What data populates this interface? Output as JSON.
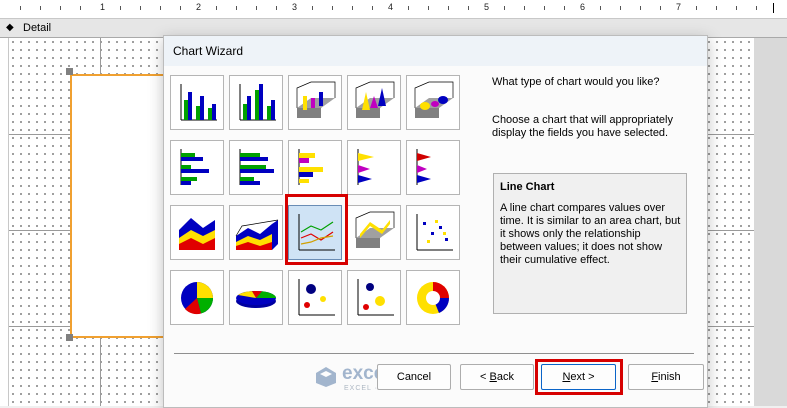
{
  "ruler": {
    "numbers": [
      "1",
      "2",
      "3",
      "4",
      "5",
      "6",
      "7"
    ]
  },
  "section": {
    "caret": "◆",
    "label": "Detail"
  },
  "dialog": {
    "title": "Chart Wizard",
    "question": "What type of chart would you like?",
    "instructions": "Choose a chart that will appropriately display the fields you have selected.",
    "info_title": "Line Chart",
    "info_text": "A line chart compares values over time. It is similar to an area chart, but it shows only the relationship between values; it does not show their cumulative effect.",
    "chart_types_selected": "Line Chart",
    "buttons": {
      "cancel": "Cancel",
      "back_pre": "< ",
      "back_acc": "B",
      "back_post": "ack",
      "next_pre": "",
      "next_acc": "N",
      "next_post": "ext >",
      "finish_pre": "",
      "finish_acc": "F",
      "finish_post": "inish"
    }
  },
  "watermark": {
    "name": "exceldemy",
    "tagline": "EXCEL · DATA · BI"
  },
  "colors": {
    "highlight": "#d60000",
    "placeholder_border": "#f0a030",
    "selected_bg": "#cfe3f5"
  },
  "icons": [
    "column-chart-icon",
    "stacked-column-chart-icon",
    "3d-column-chart-icon",
    "3d-cone-chart-icon",
    "3d-pyramid-chart-icon",
    "bar-chart-icon",
    "stacked-bar-chart-icon",
    "3d-bar-chart-icon",
    "cone-bar-chart-icon",
    "pyramid-bar-chart-icon",
    "area-chart-icon",
    "3d-area-chart-icon",
    "line-chart-icon",
    "3d-line-chart-icon",
    "xy-scatter-chart-icon",
    "pie-chart-icon",
    "3d-pie-chart-icon",
    "bubble-chart-icon",
    "3d-bubble-chart-icon",
    "doughnut-chart-icon"
  ]
}
